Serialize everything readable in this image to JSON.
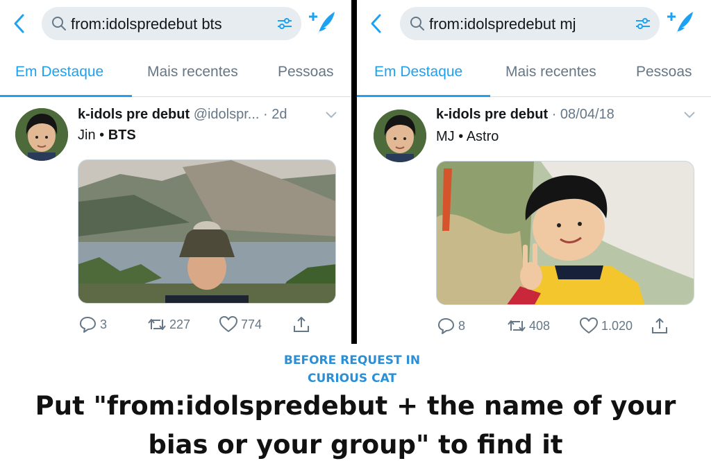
{
  "colors": {
    "accent": "#1da1f2",
    "caption_blue": "#2a8fd6",
    "muted": "#657786",
    "search_bg": "#e6ecf0"
  },
  "tabs": {
    "featured": "Em Destaque",
    "latest": "Mais recentes",
    "people": "Pessoas"
  },
  "left": {
    "search_query": "from:idolspredebut bts",
    "tweet": {
      "name": "k-idols pre debut",
      "meta": "@idolspr... · 2d",
      "line": {
        "idol": "Jin",
        "sep": " • ",
        "group": "BTS"
      },
      "replies": "3",
      "retweets": "227",
      "likes": "774"
    }
  },
  "right": {
    "search_query": "from:idolspredebut mj",
    "tweet": {
      "name": "k-idols pre debut",
      "meta": "· 08/04/18",
      "line": {
        "idol": "MJ",
        "sep": " • ",
        "group": "Astro"
      },
      "replies": "8",
      "retweets": "408",
      "likes": "1.020"
    }
  },
  "caption": {
    "small_line1": "BEFORE REQUEST IN",
    "small_line2": "CURIOUS CAT",
    "big_line1": "Put \"from:idolspredebut + the name of your",
    "big_line2": "bias or your group\" to find it"
  },
  "icons": [
    "back-icon",
    "search-icon",
    "filter-icon",
    "compose-icon",
    "caret-icon",
    "reply-icon",
    "retweet-icon",
    "like-icon",
    "share-icon"
  ]
}
